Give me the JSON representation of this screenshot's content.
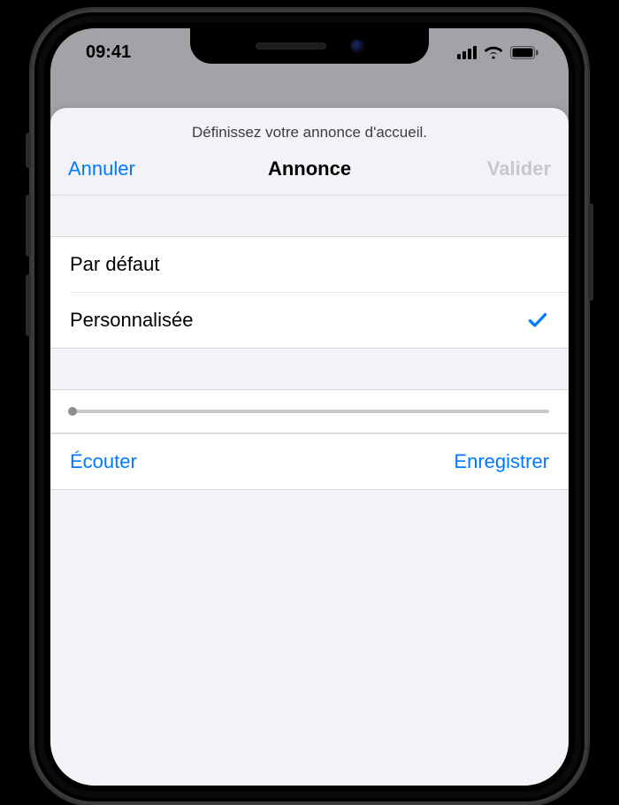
{
  "status": {
    "time": "09:41"
  },
  "sheet": {
    "prompt": "Définissez votre annonce d'accueil.",
    "nav": {
      "cancel": "Annuler",
      "title": "Annonce",
      "done": "Valider"
    },
    "options": {
      "default": "Par défaut",
      "custom": "Personnalisée",
      "selected": "custom"
    },
    "actions": {
      "play": "Écouter",
      "record": "Enregistrer"
    }
  }
}
